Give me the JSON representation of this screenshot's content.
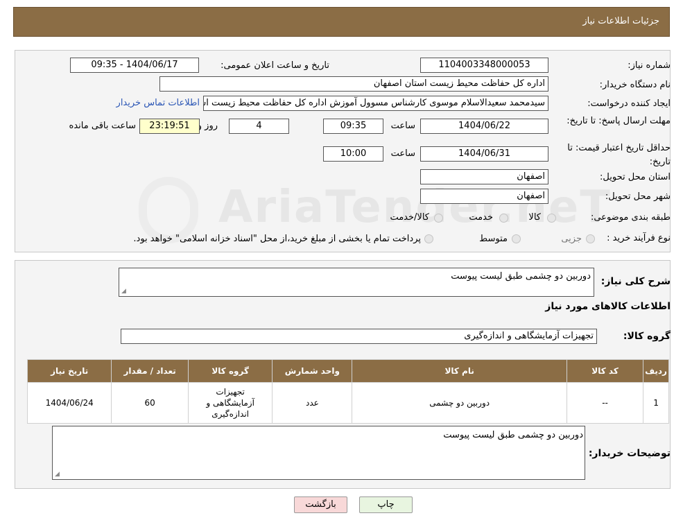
{
  "header": {
    "title": "جزئیات اطلاعات نیاز"
  },
  "form": {
    "need_number_label": "شماره نیاز:",
    "need_number": "1104003348000053",
    "announce_label": "تاریخ و ساعت اعلان عمومی:",
    "announce_value": "1404/06/17 - 09:35",
    "buyer_org_label": "نام دستگاه خریدار:",
    "buyer_org": "اداره کل حفاظت محیط زیست استان اصفهان",
    "creator_label": "ایجاد کننده درخواست:",
    "creator": "سیدمحمد سعیدالاسلام موسوی کارشناس مسوول آموزش اداره کل حفاظت محیط زیست استان اصفهان",
    "contact_link": "اطلاعات تماس خریدار",
    "reply_deadline_label": "مهلت ارسال پاسخ: تا تاریخ:",
    "reply_date": "1404/06/22",
    "time_label": "ساعت",
    "reply_time": "09:35",
    "days": "4",
    "days_label": "روز و",
    "remaining_time": "23:19:51",
    "remaining_label": "ساعت باقی مانده",
    "price_validity_label": "حداقل تاریخ اعتبار قیمت: تا تاریخ:",
    "price_date": "1404/06/31",
    "price_time": "10:00",
    "province_label": "استان محل تحویل:",
    "province": "اصفهان",
    "city_label": "شهر محل تحویل:",
    "city": "اصفهان",
    "category_label": "طبقه بندی موضوعی:",
    "category_options": [
      "کالا",
      "خدمت",
      "کالا/خدمت"
    ],
    "purchase_type_label": "نوع فرآیند خرید :",
    "purchase_options": [
      "جزیی",
      "متوسط"
    ],
    "purchase_note": "پرداخت تمام یا بخشی از مبلغ خرید،از محل \"اسناد خزانه اسلامی\" خواهد بود."
  },
  "details": {
    "summary_label": "شرح کلی نیاز:",
    "summary": "دوربین دو چشمی طبق لیست پیوست",
    "goods_title": "اطلاعات کالاهای مورد نیاز",
    "group_label": "گروه کالا:",
    "group": "تجهیزات آزمایشگاهی و اندازه‌گیری",
    "table": {
      "headers": [
        "ردیف",
        "کد کالا",
        "نام کالا",
        "واحد شمارش",
        "گروه کالا",
        "تعداد / مقدار",
        "تاریخ نیاز"
      ],
      "rows": [
        [
          "1",
          "--",
          "دوربین دو چشمی",
          "عدد",
          "تجهیزات آزمایشگاهی و اندازه‌گیری",
          "60",
          "1404/06/24"
        ]
      ]
    },
    "buyer_notes_label": "توضیحات خریدار:",
    "buyer_notes": "دوربین دو چشمی طبق لیست پیوست"
  },
  "buttons": {
    "print": "چاپ",
    "back": "بازگشت"
  },
  "watermark": "AriaTender.neT",
  "colors": {
    "header": "#8b6d45",
    "link": "#2b56b5",
    "back_button": "#f8d8d8",
    "print_button": "#e8f5e0",
    "remaining_box": "#ffffcc"
  }
}
